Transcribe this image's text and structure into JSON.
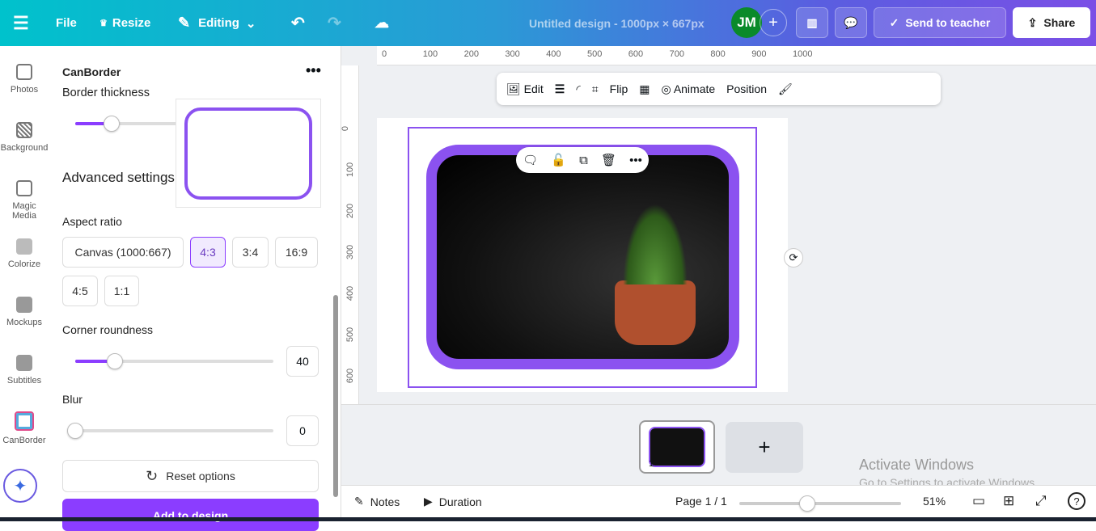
{
  "topbar": {
    "menu_icon": "hamburger-icon",
    "file": "File",
    "resize": "Resize",
    "editing": "Editing",
    "title": "Untitled design - 1000px × 667px",
    "avatar": "JM",
    "send": "Send to teacher",
    "share": "Share"
  },
  "rail": [
    {
      "label": "Photos",
      "icon": "photo-icon"
    },
    {
      "label": "Background",
      "icon": "background-icon"
    },
    {
      "label": "Magic Media",
      "icon": "magic-media-icon"
    },
    {
      "label": "Colorize",
      "icon": "colorize-icon"
    },
    {
      "label": "Mockups",
      "icon": "mockups-icon"
    },
    {
      "label": "Subtitles",
      "icon": "subtitles-icon"
    },
    {
      "label": "CanBorder",
      "icon": "canborder-icon"
    }
  ],
  "panel": {
    "title": "CanBorder",
    "border_thickness": "Border thickness",
    "border_thickness_value": 20,
    "advanced": "Advanced settings",
    "aspect_ratio": "Aspect ratio",
    "ratios": [
      "Canvas (1000:667)",
      "4:3",
      "3:4",
      "16:9",
      "4:5",
      "1:1"
    ],
    "selected_ratio": "4:3",
    "corner": "Corner roundness",
    "corner_value": "40",
    "blur": "Blur",
    "blur_value": "0",
    "reset": "Reset options",
    "add": "Add to design",
    "accent": "#8b3dff"
  },
  "ruler": {
    "x": [
      "0",
      "100",
      "200",
      "300",
      "400",
      "500",
      "600",
      "700",
      "800",
      "900",
      "1000"
    ],
    "y": [
      "0",
      "100",
      "200",
      "300",
      "400",
      "500",
      "600"
    ]
  },
  "toolbar": {
    "edit": "Edit",
    "flip": "Flip",
    "animate": "Animate",
    "position": "Position"
  },
  "pages": {
    "thumb_number": "1"
  },
  "footer": {
    "notes": "Notes",
    "duration": "Duration",
    "page": "Page 1 / 1",
    "zoom": "51%",
    "zoom_value": 51
  },
  "watermark": {
    "title": "Activate Windows",
    "sub": "Go to Settings to activate Windows."
  }
}
